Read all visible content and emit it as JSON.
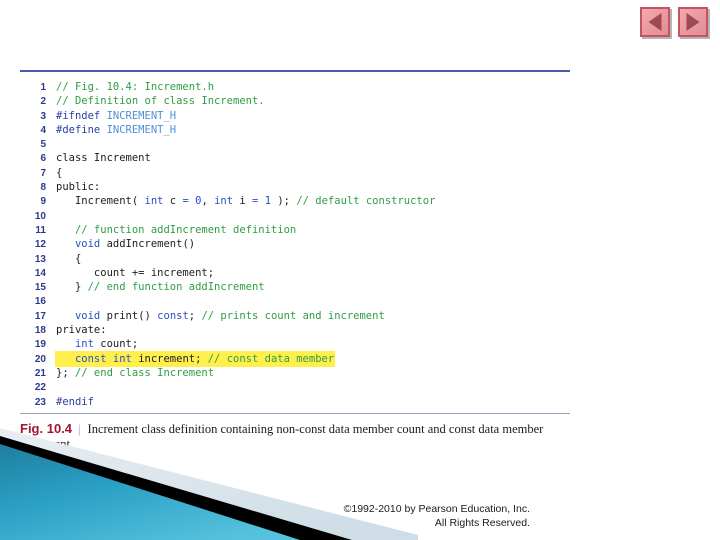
{
  "nav": {
    "prev_label": "Previous slide",
    "prev_icon": "triangle-left-icon",
    "next_label": "Next slide",
    "next_icon": "triangle-right-icon"
  },
  "colors": {
    "rule_top": "#4a5aa8",
    "rule_bottom": "#9aa2bd",
    "comment": "#2f9e44",
    "keyword": "#2b4fc4",
    "macro": "#4e8fd6",
    "line_number": "#2b3a8f",
    "highlight": "#ffef4d",
    "fig_number": "#a31432",
    "deco_teal": "#1b89ad",
    "nav_button": "#eb9aa0"
  },
  "code": {
    "lines": [
      {
        "n": "1",
        "highlight": false,
        "tokens": [
          {
            "t": "// Fig. 10.4: Increment.h",
            "c": "com"
          }
        ]
      },
      {
        "n": "2",
        "highlight": false,
        "tokens": [
          {
            "t": "// Definition of class Increment.",
            "c": "com"
          }
        ]
      },
      {
        "n": "3",
        "highlight": false,
        "tokens": [
          {
            "t": "#ifndef ",
            "c": "pre"
          },
          {
            "t": "INCREMENT_H",
            "c": "mac"
          }
        ]
      },
      {
        "n": "4",
        "highlight": false,
        "tokens": [
          {
            "t": "#define ",
            "c": "pre"
          },
          {
            "t": "INCREMENT_H",
            "c": "mac"
          }
        ]
      },
      {
        "n": "5",
        "highlight": false,
        "tokens": []
      },
      {
        "n": "6",
        "highlight": false,
        "tokens": [
          {
            "t": "class Increment",
            "c": "pln"
          }
        ]
      },
      {
        "n": "7",
        "highlight": false,
        "tokens": [
          {
            "t": "{",
            "c": "pln"
          }
        ]
      },
      {
        "n": "8",
        "highlight": false,
        "tokens": [
          {
            "t": "public:",
            "c": "pln"
          }
        ]
      },
      {
        "n": "9",
        "highlight": false,
        "tokens": [
          {
            "t": "   Increment( ",
            "c": "pln"
          },
          {
            "t": "int",
            "c": "kw"
          },
          {
            "t": " c ",
            "c": "pln"
          },
          {
            "t": "=",
            "c": "kw"
          },
          {
            "t": " ",
            "c": "pln"
          },
          {
            "t": "0",
            "c": "num"
          },
          {
            "t": ", ",
            "c": "pln"
          },
          {
            "t": "int",
            "c": "kw"
          },
          {
            "t": " i ",
            "c": "pln"
          },
          {
            "t": "=",
            "c": "kw"
          },
          {
            "t": " ",
            "c": "pln"
          },
          {
            "t": "1",
            "c": "num"
          },
          {
            "t": " ); ",
            "c": "pln"
          },
          {
            "t": "// default constructor",
            "c": "com"
          }
        ]
      },
      {
        "n": "10",
        "highlight": false,
        "tokens": []
      },
      {
        "n": "11",
        "highlight": false,
        "tokens": [
          {
            "t": "   ",
            "c": "pln"
          },
          {
            "t": "// function addIncrement definition",
            "c": "com"
          }
        ]
      },
      {
        "n": "12",
        "highlight": false,
        "tokens": [
          {
            "t": "   ",
            "c": "pln"
          },
          {
            "t": "void",
            "c": "kw"
          },
          {
            "t": " addIncrement()",
            "c": "pln"
          }
        ]
      },
      {
        "n": "13",
        "highlight": false,
        "tokens": [
          {
            "t": "   {",
            "c": "pln"
          }
        ]
      },
      {
        "n": "14",
        "highlight": false,
        "tokens": [
          {
            "t": "      count += increment;",
            "c": "pln"
          }
        ]
      },
      {
        "n": "15",
        "highlight": false,
        "tokens": [
          {
            "t": "   } ",
            "c": "pln"
          },
          {
            "t": "// end function addIncrement",
            "c": "com"
          }
        ]
      },
      {
        "n": "16",
        "highlight": false,
        "tokens": []
      },
      {
        "n": "17",
        "highlight": false,
        "tokens": [
          {
            "t": "   ",
            "c": "pln"
          },
          {
            "t": "void",
            "c": "kw"
          },
          {
            "t": " print() ",
            "c": "pln"
          },
          {
            "t": "const",
            "c": "kw"
          },
          {
            "t": "; ",
            "c": "pln"
          },
          {
            "t": "// prints count and increment",
            "c": "com"
          }
        ]
      },
      {
        "n": "18",
        "highlight": false,
        "tokens": [
          {
            "t": "private:",
            "c": "pln"
          }
        ]
      },
      {
        "n": "19",
        "highlight": false,
        "tokens": [
          {
            "t": "   ",
            "c": "pln"
          },
          {
            "t": "int",
            "c": "kw"
          },
          {
            "t": " count;",
            "c": "pln"
          }
        ]
      },
      {
        "n": "20",
        "highlight": true,
        "tokens": [
          {
            "t": "   ",
            "c": "pln"
          },
          {
            "t": "const int",
            "c": "kw"
          },
          {
            "t": " increment; ",
            "c": "pln"
          },
          {
            "t": "// const data member",
            "c": "com"
          }
        ]
      },
      {
        "n": "21",
        "highlight": false,
        "tokens": [
          {
            "t": "}; ",
            "c": "pln"
          },
          {
            "t": "// end class Increment",
            "c": "com"
          }
        ]
      },
      {
        "n": "22",
        "highlight": false,
        "tokens": []
      },
      {
        "n": "23",
        "highlight": false,
        "tokens": [
          {
            "t": "#endif",
            "c": "pre"
          }
        ]
      }
    ]
  },
  "caption": {
    "fig_number": "Fig. 10.4",
    "separator": "|",
    "text": "Increment class definition containing non-const data member count and const data member increment."
  },
  "footer": {
    "line1": "©1992-2010 by Pearson Education, Inc.",
    "line2": "All Rights Reserved."
  }
}
